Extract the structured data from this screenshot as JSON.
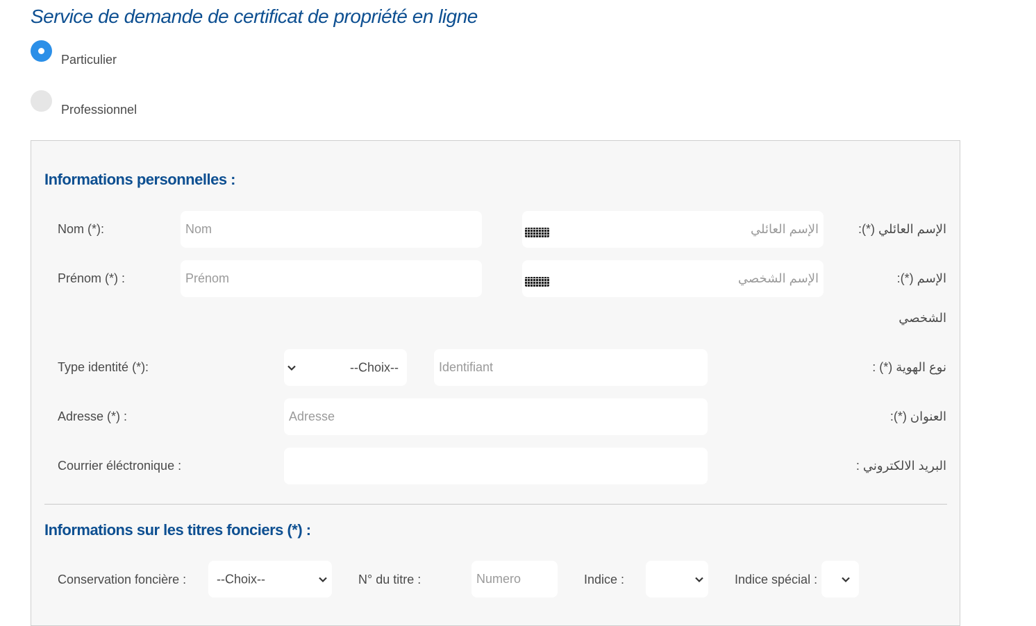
{
  "page": {
    "title": "Service de demande de certificat de propriété en ligne"
  },
  "user_type": {
    "options": [
      {
        "label": "Particulier",
        "checked": true
      },
      {
        "label": "Professionnel",
        "checked": false
      }
    ]
  },
  "personal": {
    "section_title": "Informations personnelles :",
    "nom": {
      "label_fr": "Nom (*):",
      "placeholder_fr": "Nom",
      "label_ar": "الإسم العائلي (*):",
      "placeholder_ar": "الإسم العائلي"
    },
    "prenom": {
      "label_fr": "Prénom (*) :",
      "placeholder_fr": "Prénom",
      "label_ar_1": "الإسم (*):",
      "label_ar_2": "الشخصي",
      "placeholder_ar": "الإسم الشخصي"
    },
    "type_identite": {
      "label_fr": "Type identité (*):",
      "select_value": "--Choix--",
      "placeholder": "Identifiant",
      "label_ar": "نوع الهوية (*) :"
    },
    "adresse": {
      "label_fr": "Adresse (*) :",
      "placeholder": "Adresse",
      "label_ar": "العنوان (*):"
    },
    "email": {
      "label_fr": "Courrier éléctronique :",
      "placeholder": "",
      "label_ar": "البريد الالكتروني :"
    }
  },
  "titres": {
    "section_title": "Informations sur les titres fonciers (*) :",
    "conservation": {
      "label": "Conservation foncière :",
      "select_value": "--Choix--"
    },
    "numero": {
      "label": "N° du titre :",
      "placeholder": "Numero"
    },
    "indice": {
      "label": "Indice :",
      "select_value": ""
    },
    "indice_special": {
      "label": "Indice spécial :",
      "select_value": ""
    }
  },
  "icons": {
    "keyboard": "keyboard-icon",
    "chevron": "chevron-down-icon",
    "radio": "radio-icon"
  },
  "colors": {
    "title": "#0d4f91",
    "radio_checked": "#2b8fe8",
    "panel_bg": "#f7f7f7"
  }
}
